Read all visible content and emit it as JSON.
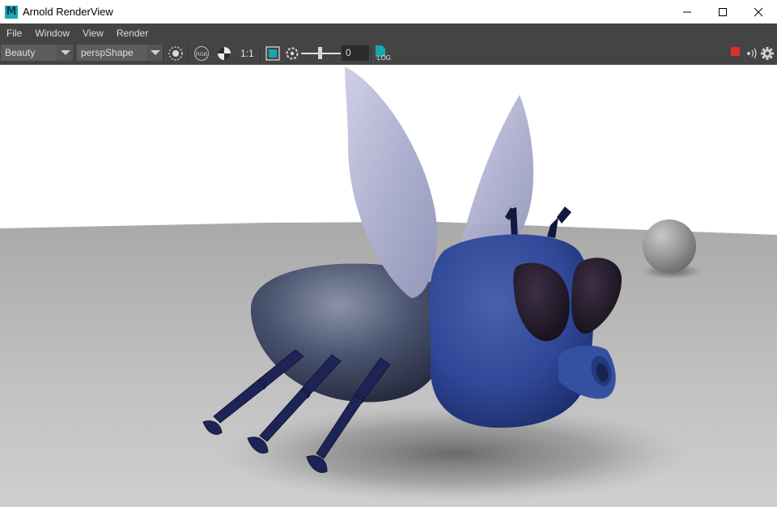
{
  "window": {
    "title": "Arnold RenderView",
    "app_icon": "M"
  },
  "menu": {
    "items": [
      "File",
      "Window",
      "View",
      "Render"
    ]
  },
  "toolbar": {
    "aov_select": "Beauty",
    "camera_select": "perspShape",
    "ratio_label": "1:1",
    "exposure_value": "0",
    "log_label": "LOG",
    "colors": {
      "accent": "#16a7b0",
      "stop": "#d9302c"
    }
  }
}
